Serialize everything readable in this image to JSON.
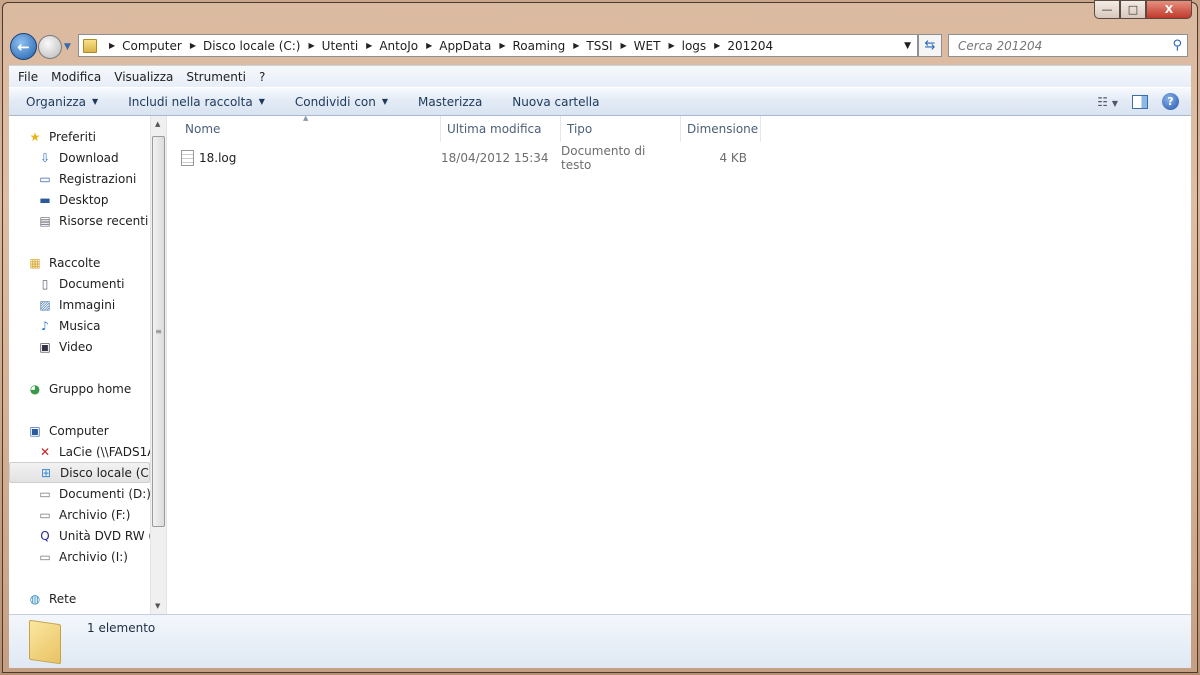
{
  "window": {
    "minimize": "—",
    "maximize": "□",
    "close": "X"
  },
  "address": {
    "crumbs": [
      "Computer",
      "Disco locale (C:)",
      "Utenti",
      "AntoJo",
      "AppData",
      "Roaming",
      "TSSI",
      "WET",
      "logs",
      "201204"
    ]
  },
  "search": {
    "placeholder": "Cerca 201204"
  },
  "menu": [
    "File",
    "Modifica",
    "Visualizza",
    "Strumenti",
    "?"
  ],
  "toolbar": {
    "organize": "Organizza",
    "include": "Includi nella raccolta",
    "share": "Condividi con",
    "burn": "Masterizza",
    "new_folder": "Nuova cartella"
  },
  "sidebar": [
    {
      "label": "Preferiti",
      "icon": "star",
      "h": true
    },
    {
      "label": "Download",
      "icon": "download"
    },
    {
      "label": "Registrazioni",
      "icon": "monitor"
    },
    {
      "label": "Desktop",
      "icon": "desktop"
    },
    {
      "label": "Risorse recenti",
      "icon": "recent"
    },
    {
      "label": "Raccolte",
      "icon": "library",
      "h": true
    },
    {
      "label": "Documenti",
      "icon": "document"
    },
    {
      "label": "Immagini",
      "icon": "image"
    },
    {
      "label": "Musica",
      "icon": "music"
    },
    {
      "label": "Video",
      "icon": "video"
    },
    {
      "label": "Gruppo home",
      "icon": "homegroup",
      "h": true
    },
    {
      "label": "Computer",
      "icon": "computer",
      "h": true
    },
    {
      "label": "LaCie (\\\\FADS1A\\",
      "icon": "network-drive-disconnected"
    },
    {
      "label": "Disco locale (C:)",
      "icon": "system-drive",
      "sel": true
    },
    {
      "label": "Documenti (D:)",
      "icon": "drive"
    },
    {
      "label": "Archivio (F:)",
      "icon": "drive"
    },
    {
      "label": "Unità DVD RW (G",
      "icon": "dvd"
    },
    {
      "label": "Archivio (I:)",
      "icon": "drive"
    },
    {
      "label": "Rete",
      "icon": "network",
      "h": true
    }
  ],
  "columns": [
    "Nome",
    "Ultima modifica",
    "Tipo",
    "Dimensione"
  ],
  "files": [
    {
      "name": "18.log",
      "modified": "18/04/2012 15:34",
      "type": "Documento di testo",
      "size": "4 KB"
    }
  ],
  "status": {
    "count": "1 elemento"
  }
}
